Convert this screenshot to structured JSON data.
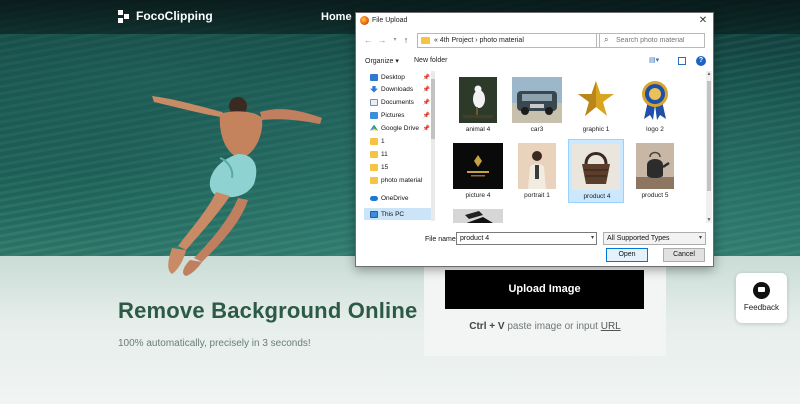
{
  "site": {
    "brand": "FocoClipping",
    "nav_home": "Home",
    "headline": "Remove Background Online",
    "subline": "100% automatically, precisely in 3 seconds!",
    "upload_label": "Upload Image",
    "paste_keys": "Ctrl + V",
    "paste_text": " paste image or input ",
    "paste_link": "URL",
    "feedback_label": "Feedback"
  },
  "dialog": {
    "title": "File Upload",
    "breadcrumb": "«  4th Project  ›  photo material",
    "search_placeholder": "Search photo material",
    "organize": "Organize ▾",
    "new_folder": "New folder",
    "nav_items": [
      {
        "label": "Desktop",
        "icon": "desktop-icon"
      },
      {
        "label": "Downloads",
        "icon": "downloads-icon"
      },
      {
        "label": "Documents",
        "icon": "documents-icon"
      },
      {
        "label": "Pictures",
        "icon": "pictures-icon"
      },
      {
        "label": "Google Drive",
        "icon": "google-drive-icon"
      },
      {
        "label": "1",
        "icon": "folder-icon"
      },
      {
        "label": "11",
        "icon": "folder-icon"
      },
      {
        "label": "15",
        "icon": "folder-icon"
      },
      {
        "label": "photo material",
        "icon": "folder-icon"
      },
      {
        "label": "OneDrive",
        "icon": "onedrive-icon"
      },
      {
        "label": "This PC",
        "icon": "this-pc-icon"
      }
    ],
    "files": [
      {
        "name": "animal 4"
      },
      {
        "name": "car3"
      },
      {
        "name": "graphic 1"
      },
      {
        "name": "logo 2"
      },
      {
        "name": "picture 4"
      },
      {
        "name": "portrait 1"
      },
      {
        "name": "product 4"
      },
      {
        "name": "product 5"
      },
      {
        "name": ""
      }
    ],
    "file_name_label": "File name:",
    "file_name_value": "product 4",
    "file_type": "All Supported Types",
    "open_label": "Open",
    "cancel_label": "Cancel"
  }
}
